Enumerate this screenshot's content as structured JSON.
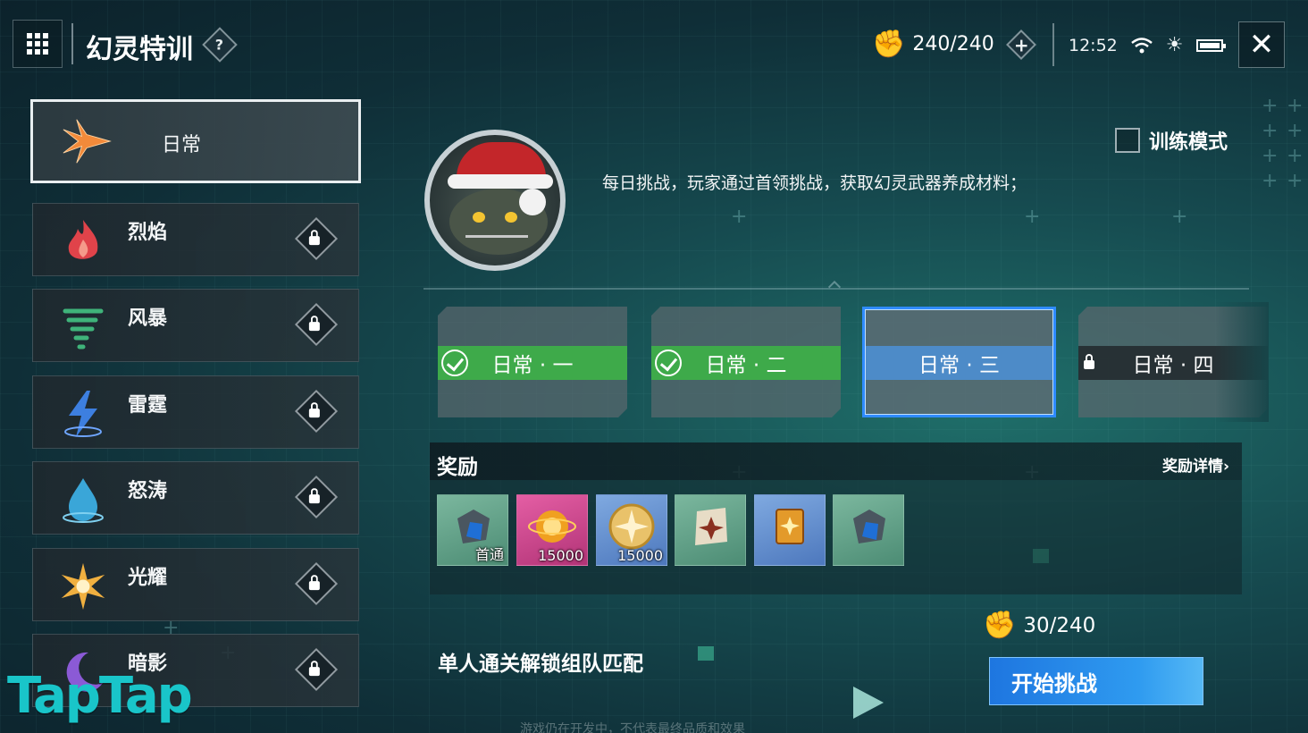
{
  "header": {
    "title": "幻灵特训",
    "help_label": "?",
    "stamina": "240/240",
    "time": "12:52"
  },
  "sidebar": {
    "items": [
      {
        "label": "日常",
        "icon": "spark-star-icon",
        "color": "#f28a3a",
        "active": true,
        "locked": false
      },
      {
        "label": "烈焰",
        "icon": "flame-icon",
        "color": "#e0434a",
        "active": false,
        "locked": true
      },
      {
        "label": "风暴",
        "icon": "tornado-icon",
        "color": "#3fb37a",
        "active": false,
        "locked": true
      },
      {
        "label": "雷霆",
        "icon": "lightning-icon",
        "color": "#3d7fe0",
        "active": false,
        "locked": true
      },
      {
        "label": "怒涛",
        "icon": "water-drop-icon",
        "color": "#3aa6d8",
        "active": false,
        "locked": true
      },
      {
        "label": "光耀",
        "icon": "radiant-sun-icon",
        "color": "#f0b040",
        "active": false,
        "locked": true
      },
      {
        "label": "暗影",
        "icon": "crescent-moon-icon",
        "color": "#8b5ad6",
        "active": false,
        "locked": true
      }
    ]
  },
  "main": {
    "description": "每日挑战，玩家通过首领挑战，获取幻灵武器养成材料；",
    "training_mode_label": "训练模式",
    "stages": [
      {
        "label": "日常 · 一",
        "state": "completed"
      },
      {
        "label": "日常 · 二",
        "state": "completed"
      },
      {
        "label": "日常 · 三",
        "state": "selected"
      },
      {
        "label": "日常 · 四",
        "state": "locked"
      }
    ],
    "rewards": {
      "title": "奖励",
      "details_link": "奖励详情",
      "items": [
        {
          "icon": "blue-ore-icon",
          "tag": "首通",
          "bg": "green"
        },
        {
          "icon": "gold-orb-icon",
          "tag": "15000",
          "bg": "pink"
        },
        {
          "icon": "gold-coin-icon",
          "tag": "15000",
          "bg": "blue"
        },
        {
          "icon": "scroll-emblem-icon",
          "tag": "",
          "bg": "green"
        },
        {
          "icon": "gold-book-icon",
          "tag": "",
          "bg": "blue"
        },
        {
          "icon": "blue-ore-icon",
          "tag": "",
          "bg": "green"
        }
      ]
    },
    "unlock_text": "单人通关解锁组队匹配",
    "cost": "30/240",
    "start_button": "开始挑战",
    "notice": "游戏仍在开发中，不代表最终品质和效果"
  },
  "watermark": "TapTap"
}
